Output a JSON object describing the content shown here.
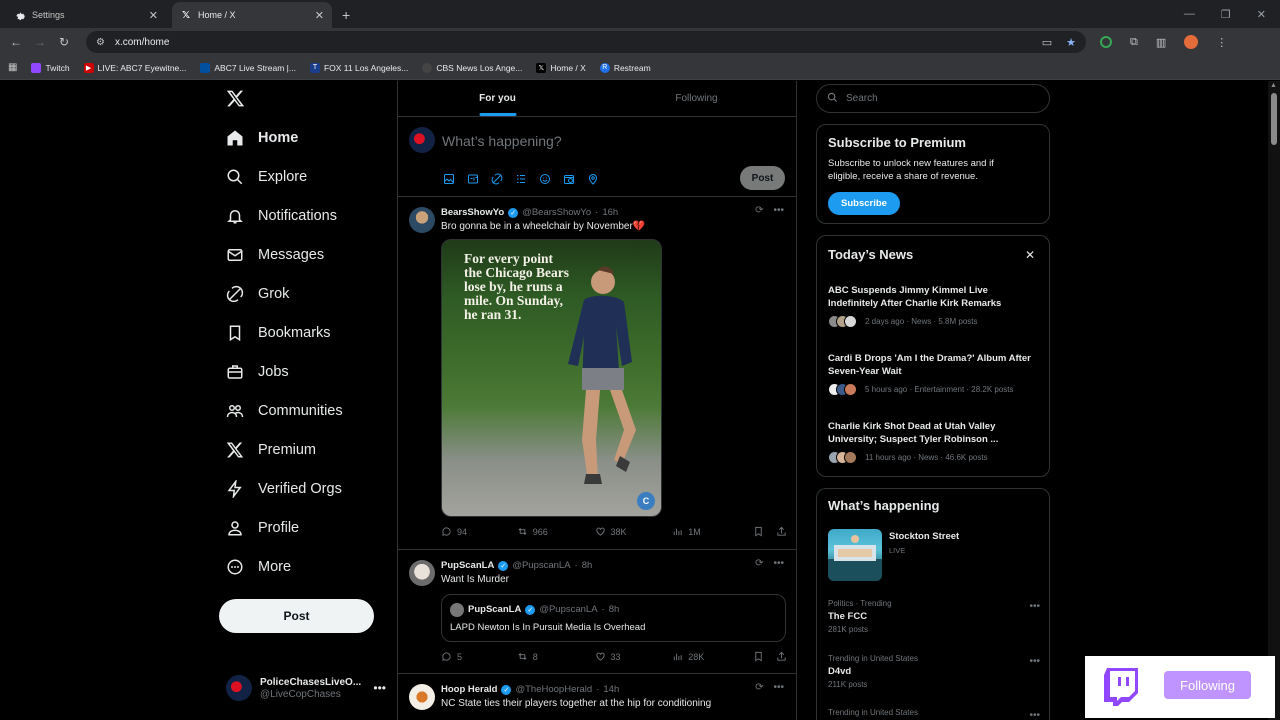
{
  "browser": {
    "tabs": [
      {
        "title": "Settings",
        "icon": "gear-icon"
      },
      {
        "title": "Home / X",
        "icon": "x-logo-icon"
      }
    ],
    "url": "x.com/home",
    "bookmarks": [
      {
        "label": "Twitch",
        "color": "#9146ff"
      },
      {
        "label": "LIVE: ABC7 Eyewitne...",
        "color": "#cc0000"
      },
      {
        "label": "ABC7 Live Stream |...",
        "color": "#0050a0"
      },
      {
        "label": "FOX 11 Los Angeles...",
        "color": "#1a3e8a"
      },
      {
        "label": "CBS News Los Ange...",
        "color": "#444444"
      },
      {
        "label": "Home / X",
        "color": "#000000"
      },
      {
        "label": "Restream",
        "color": "#1f6feb"
      }
    ]
  },
  "nav": {
    "items": [
      "Home",
      "Explore",
      "Notifications",
      "Messages",
      "Grok",
      "Bookmarks",
      "Jobs",
      "Communities",
      "Premium",
      "Verified Orgs",
      "Profile",
      "More"
    ],
    "post_label": "Post",
    "account_name": "PoliceChasesLiveO...",
    "account_handle": "@LiveCopChases"
  },
  "feed": {
    "tab_for_you": "For you",
    "tab_following": "Following",
    "composer_placeholder": "What’s happening?",
    "composer_post": "Post",
    "tweets": [
      {
        "name": "BearsShowYo",
        "handle": "@BearsShowYo",
        "time": "16h",
        "text": "Bro gonna be in a wheelchair by November💔",
        "media_text": "For every point the Chicago Bears lose by, he runs a mile. On Sunday, he ran 31.",
        "replies": "94",
        "reposts": "966",
        "likes": "38K",
        "views": "1M"
      },
      {
        "name": "PupScanLA",
        "handle": "@PupscanLA",
        "time": "8h",
        "text": "Want Is Murder",
        "quote_name": "PupScanLA",
        "quote_handle": "@PupscanLA",
        "quote_time": "8h",
        "quote_text": "LAPD Newton Is In Pursuit Media Is Overhead",
        "replies": "5",
        "reposts": "8",
        "likes": "33",
        "views": "28K"
      },
      {
        "name": "Hoop Herald",
        "handle": "@TheHoopHerald",
        "time": "14h",
        "text": "NC State ties their players together at the hip for conditioning"
      }
    ]
  },
  "sidebar": {
    "search_placeholder": "Search",
    "premium_title": "Subscribe to Premium",
    "premium_text": "Subscribe to unlock new features and if eligible, receive a share of revenue.",
    "premium_button": "Subscribe",
    "news_title": "Today’s News",
    "news": [
      {
        "title": "ABC Suspends Jimmy Kimmel Live Indefinitely After Charlie Kirk Remarks",
        "meta": "2 days ago · News · 5.8M posts"
      },
      {
        "title": "Cardi B Drops 'Am I the Drama?' Album After Seven-Year Wait",
        "meta": "5 hours ago · Entertainment · 28.2K posts"
      },
      {
        "title": "Charlie Kirk Shot Dead at Utah Valley University; Suspect Tyler Robinson ...",
        "meta": "11 hours ago · News · 46.6K posts"
      }
    ],
    "happening_title": "What’s happening",
    "live_name": "Stockton Street",
    "live_tag": "LIVE",
    "trends": [
      {
        "context": "Politics · Trending",
        "name": "The FCC",
        "posts": "281K posts"
      },
      {
        "context": "Trending in United States",
        "name": "D4vd",
        "posts": "211K posts"
      },
      {
        "context": "Trending in United States",
        "name": "",
        "posts": ""
      }
    ]
  },
  "popup": {
    "button": "Following",
    "accent": "#bf94ff"
  },
  "colors": {
    "accent": "#1d9bf0",
    "background": "#000000",
    "border": "#2f3336"
  }
}
